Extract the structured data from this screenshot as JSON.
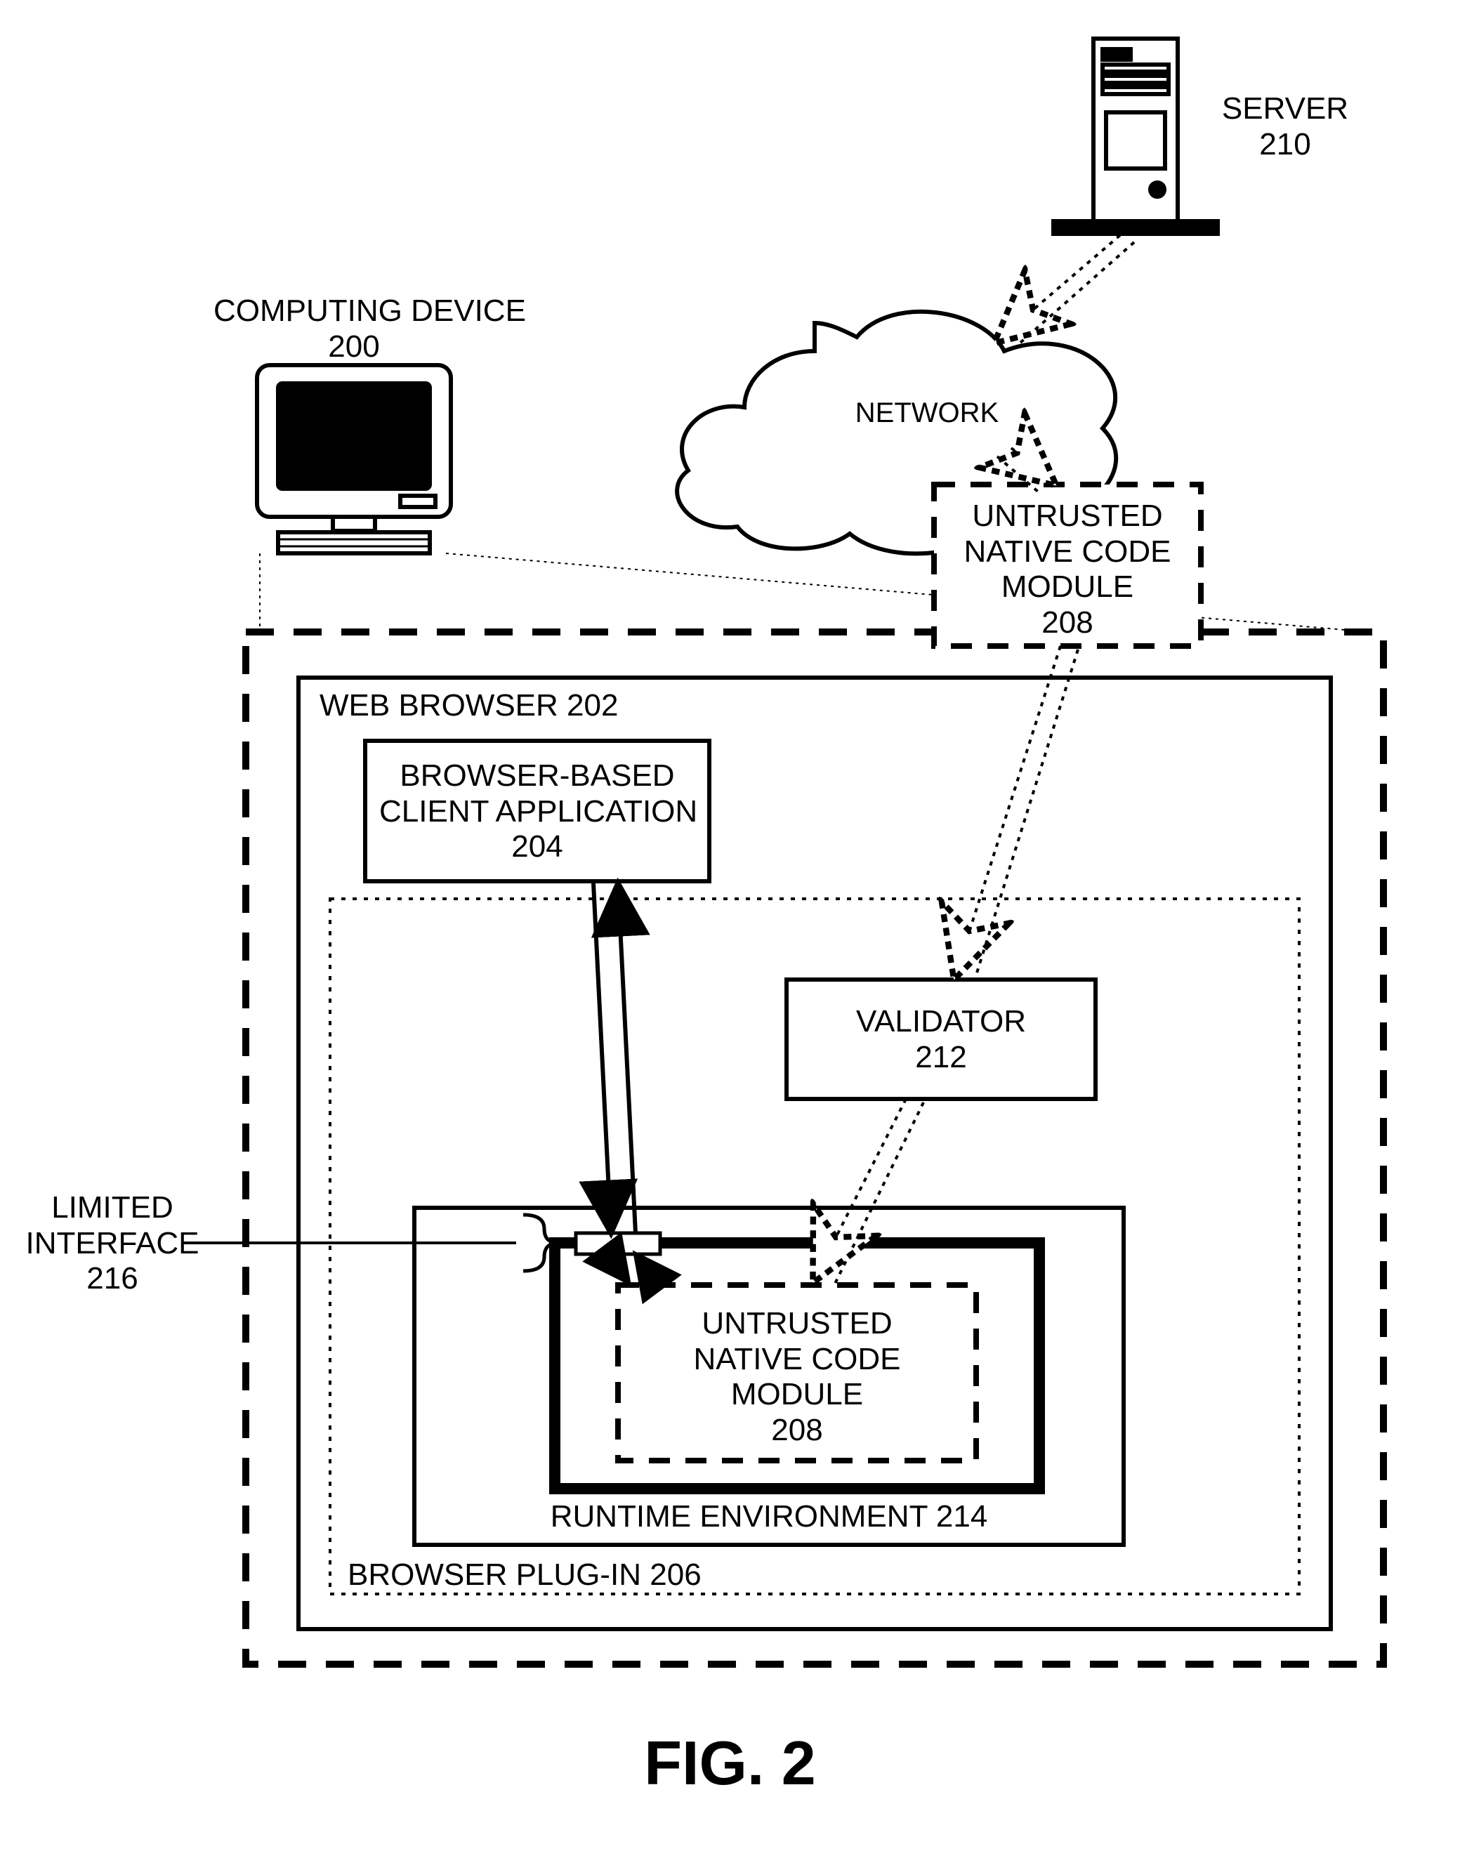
{
  "figure_label": "FIG. 2",
  "labels": {
    "computing_device": "COMPUTING DEVICE\n200",
    "server": "SERVER\n210",
    "network": "NETWORK",
    "untrusted_top": "UNTRUSTED\nNATIVE CODE\nMODULE\n208",
    "web_browser": "WEB BROWSER 202",
    "client_app": "BROWSER-BASED\nCLIENT APPLICATION\n204",
    "validator": "VALIDATOR\n212",
    "runtime_env": "RUNTIME ENVIRONMENT 214",
    "untrusted_inner": "UNTRUSTED\nNATIVE CODE\nMODULE\n208",
    "plugin": "BROWSER PLUG-IN 206",
    "limited_interface": "LIMITED\nINTERFACE\n216"
  }
}
